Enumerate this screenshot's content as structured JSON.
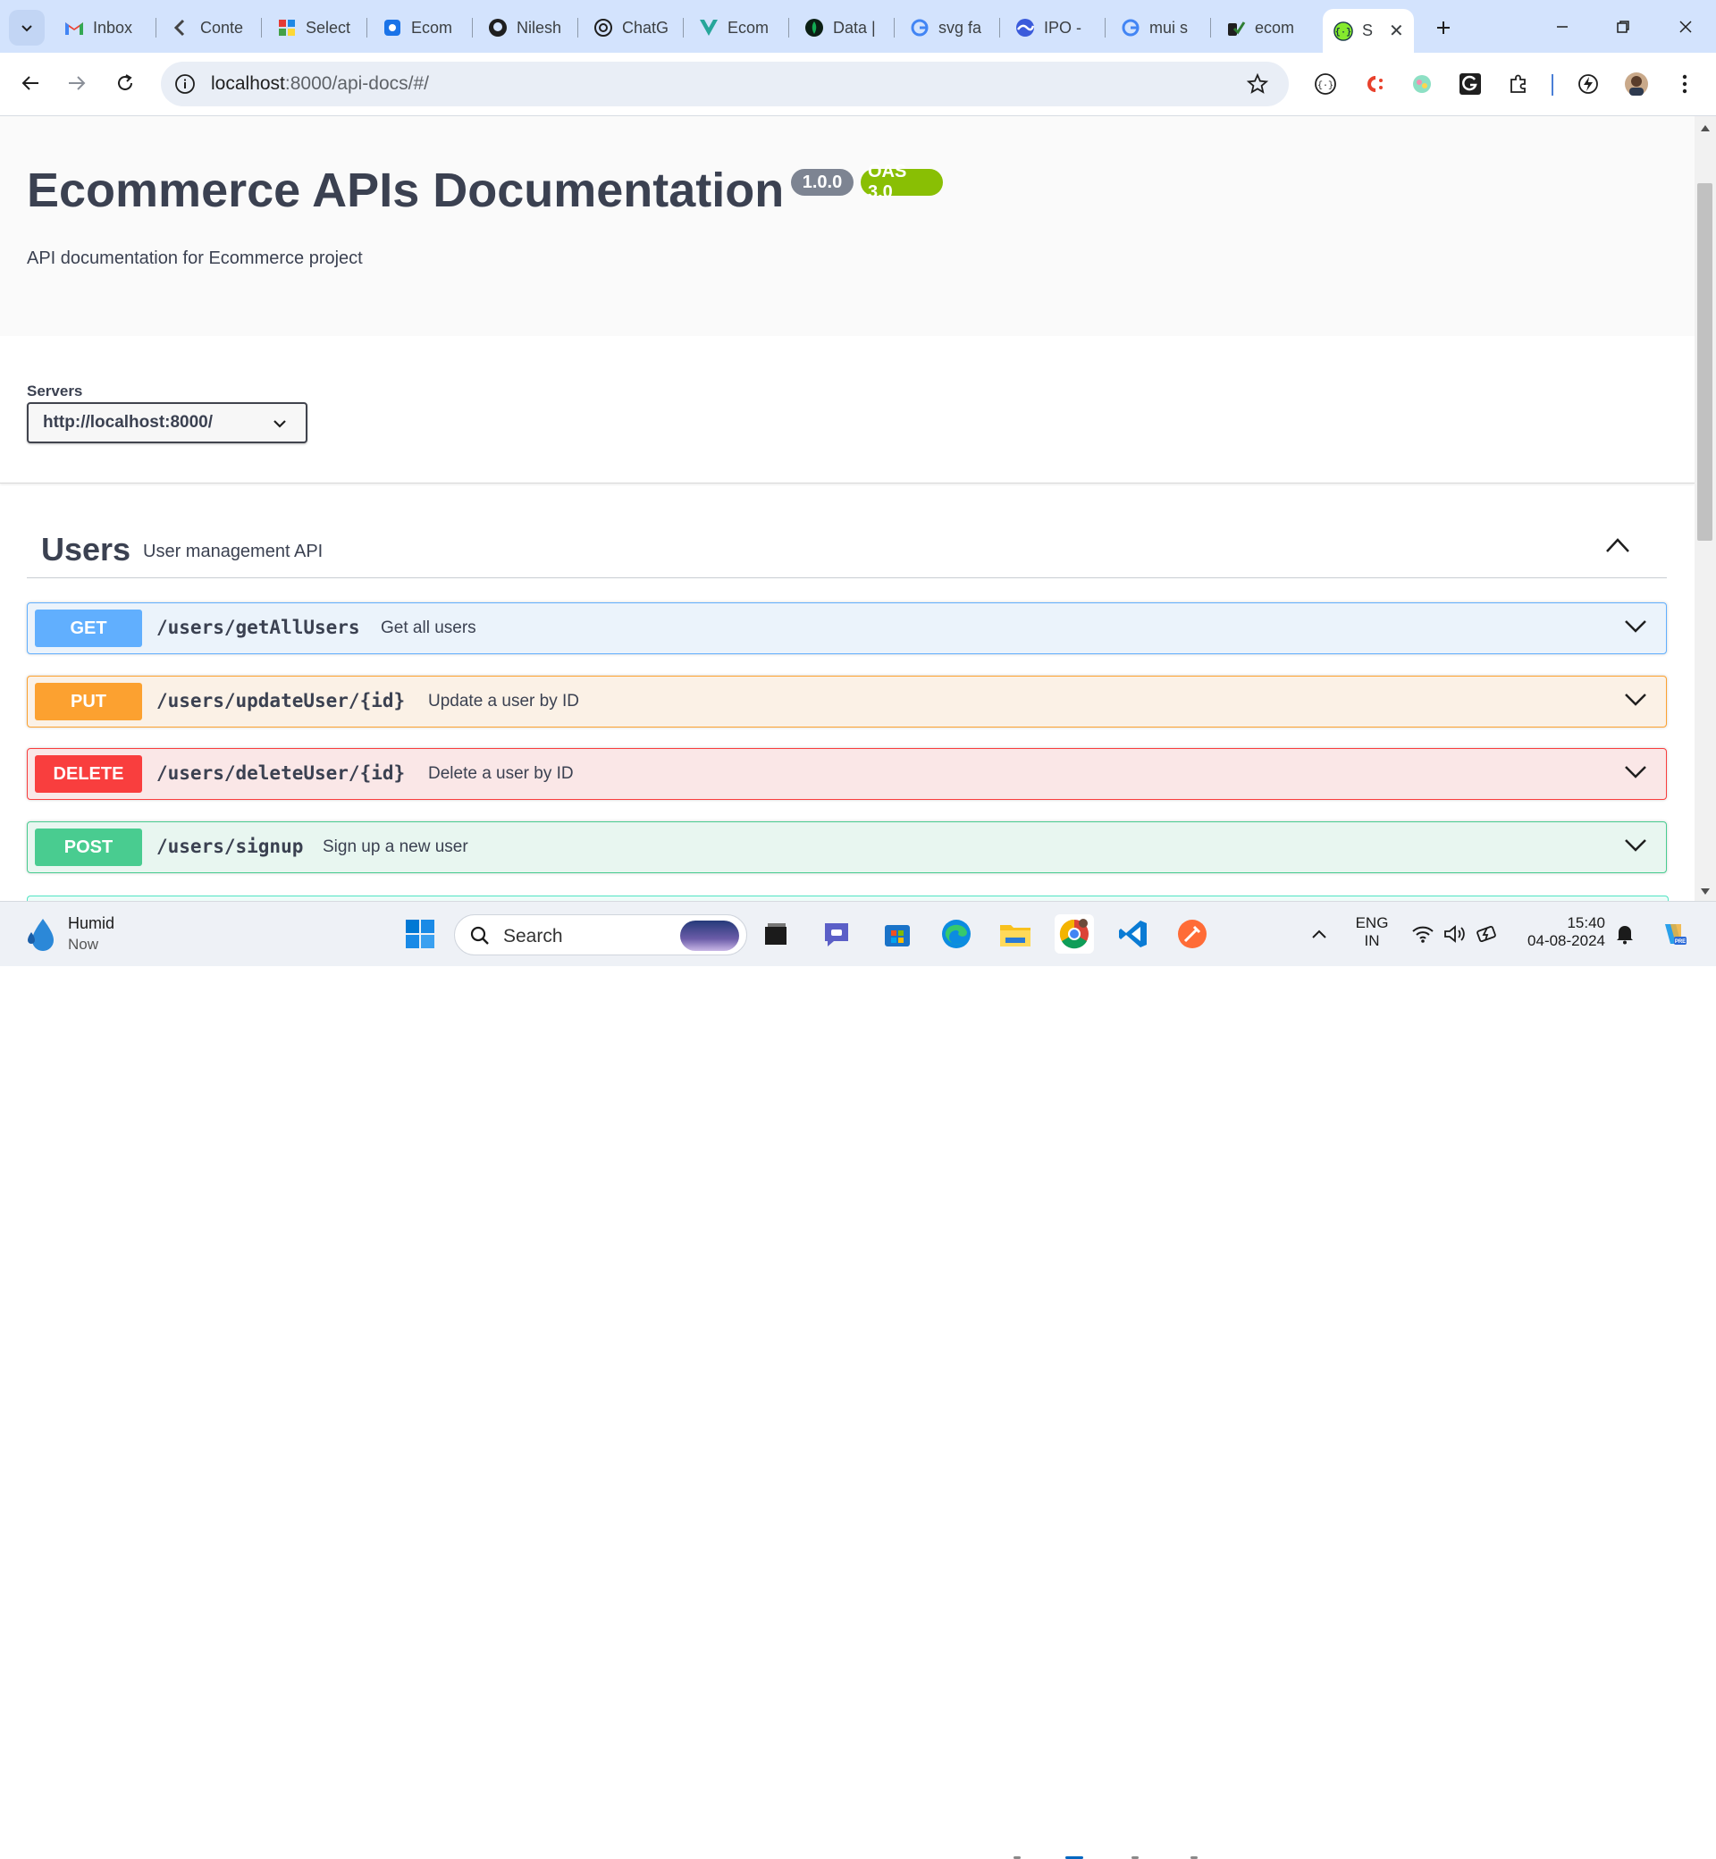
{
  "browser": {
    "tabs": [
      {
        "label": "Inbox",
        "icon": "gmail-icon"
      },
      {
        "label": "Conte",
        "icon": "contentstack-icon"
      },
      {
        "label": "Select",
        "icon": "app-grid-icon"
      },
      {
        "label": "Ecom",
        "icon": "vite-icon"
      },
      {
        "label": "Nilesh",
        "icon": "github-icon"
      },
      {
        "label": "ChatG",
        "icon": "chatgpt-icon"
      },
      {
        "label": "Ecom",
        "icon": "vercel-v-icon"
      },
      {
        "label": "Data |",
        "icon": "mongodb-leaf-icon"
      },
      {
        "label": "svg fa",
        "icon": "google-icon"
      },
      {
        "label": "IPO -",
        "icon": "wave-icon"
      },
      {
        "label": "mui s",
        "icon": "google-icon"
      },
      {
        "label": "ecom",
        "icon": "render-icon"
      },
      {
        "label": "S",
        "icon": "swagger-icon",
        "active": true
      }
    ],
    "url_host": "localhost",
    "url_rest": ":8000/api-docs/#/"
  },
  "page": {
    "title": "Ecommerce APIs Documentation",
    "version_badge": "1.0.0",
    "oas_badge": "OAS 3.0",
    "description": "API documentation for Ecommerce project",
    "servers_label": "Servers",
    "servers_selected": "http://localhost:8000/",
    "tag": {
      "name": "Users",
      "description": "User management API"
    },
    "operations": [
      {
        "method": "GET",
        "path": "/users/getAllUsers",
        "summary": "Get all users",
        "color": "#61affe"
      },
      {
        "method": "PUT",
        "path": "/users/updateUser/{id}",
        "summary": "Update a user by ID",
        "color": "#fca130"
      },
      {
        "method": "DELETE",
        "path": "/users/deleteUser/{id}",
        "summary": "Delete a user by ID",
        "color": "#f93e3e"
      },
      {
        "method": "POST",
        "path": "/users/signup",
        "summary": "Sign up a new user",
        "color": "#49cc90"
      }
    ]
  },
  "taskbar": {
    "weather_title": "Humid",
    "weather_sub": "Now",
    "search_placeholder": "Search",
    "lang_top": "ENG",
    "lang_bottom": "IN",
    "time": "15:40",
    "date": "04-08-2024"
  }
}
